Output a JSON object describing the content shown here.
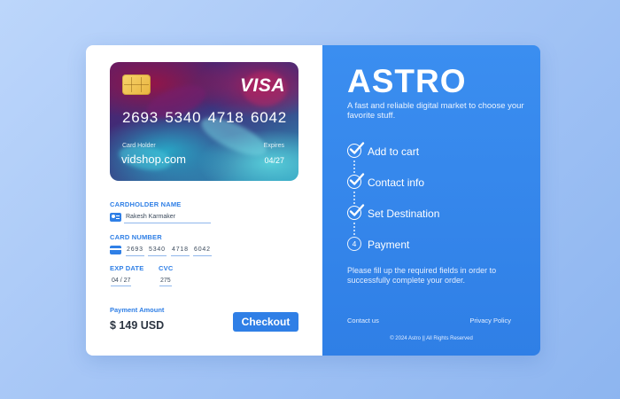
{
  "card": {
    "brand": "VISA",
    "number_groups": [
      "2693",
      "5340",
      "4718",
      "6042"
    ],
    "holder_label": "Card Holder",
    "holder_value": "vidshop.com",
    "expires_label": "Expires",
    "expires_value": "04/27"
  },
  "form": {
    "cardholder_label": "CARDHOLDER NAME",
    "cardholder_value": "Rakesh Karmaker",
    "card_number_label": "CARD NUMBER",
    "card_number_groups": [
      "2693",
      "5340",
      "4718",
      "6042"
    ],
    "exp_label": "EXP DATE",
    "exp_value": "04 / 27",
    "cvc_label": "CVC",
    "cvc_value": "275",
    "amount_label": "Payment Amount",
    "amount_value": "$ 149 USD",
    "checkout_label": "Checkout"
  },
  "brand_panel": {
    "title": "ASTRO",
    "tagline": "A fast and reliable digital market to choose your favorite stuff.",
    "steps": [
      {
        "label": "Add to cart",
        "status": "done",
        "icon": "check-icon"
      },
      {
        "label": "Contact info",
        "status": "done",
        "icon": "check-icon"
      },
      {
        "label": "Set Destination",
        "status": "done",
        "icon": "check-icon"
      },
      {
        "label": "Payment",
        "status": "current",
        "number": "4"
      }
    ],
    "instructions": "Please fill up the required fields in order to successfully complete your order.",
    "footer": {
      "contact": "Contact us",
      "privacy": "Privacy Policy",
      "copyright": "© 2024 Astro || All Rights Reserved"
    }
  },
  "colors": {
    "accent": "#2f7fe6",
    "panel_blue": "#3b8ef0",
    "background": "#a6c6f6"
  }
}
